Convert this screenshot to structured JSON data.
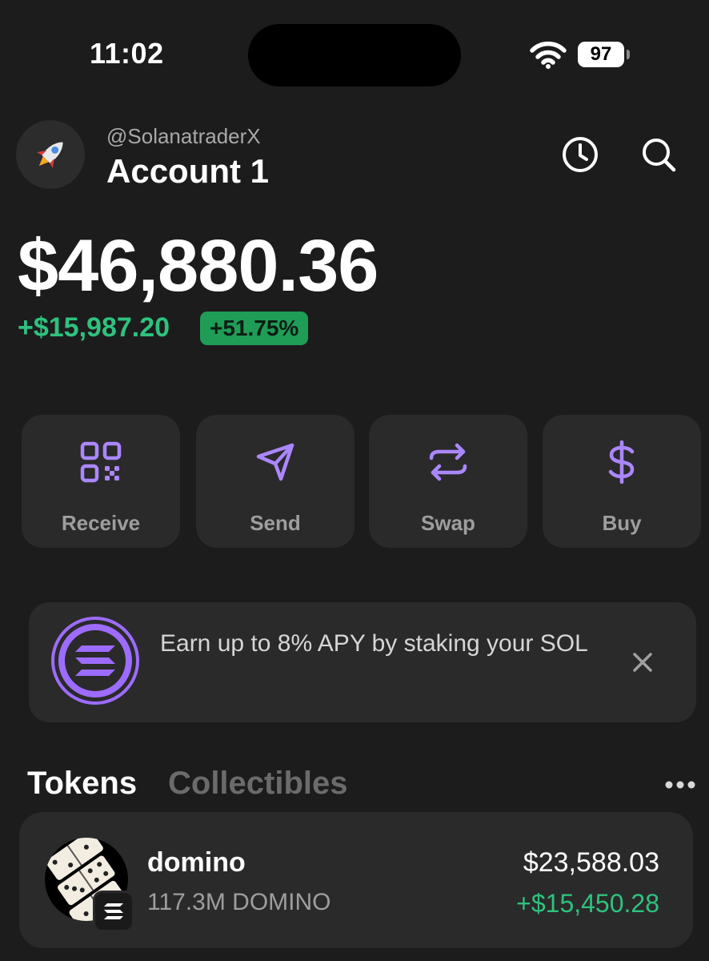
{
  "status_bar": {
    "time": "11:02",
    "battery": "97"
  },
  "header": {
    "handle": "@SolanatraderX",
    "account_name": "Account 1",
    "icons": [
      "history-icon",
      "search-icon"
    ]
  },
  "balance": {
    "total": "$46,880.36",
    "change_amount": "+$15,987.20",
    "change_percent": "+51.75%"
  },
  "actions": [
    {
      "label": "Receive",
      "icon": "qr-code-icon"
    },
    {
      "label": "Send",
      "icon": "send-icon"
    },
    {
      "label": "Swap",
      "icon": "swap-icon"
    },
    {
      "label": "Buy",
      "icon": "dollar-icon"
    }
  ],
  "banner": {
    "text": "Earn up to 8% APY by staking your SOL",
    "icon": "solana-icon"
  },
  "tabs": [
    {
      "label": "Tokens",
      "active": true
    },
    {
      "label": "Collectibles",
      "active": false
    }
  ],
  "tokens": [
    {
      "name": "domino",
      "balance": "117.3M DOMINO",
      "value": "$23,588.03",
      "change": "+$15,450.28"
    }
  ],
  "colors": {
    "background": "#1c1c1c",
    "card": "#2a2a2a",
    "accent": "#ab87ff",
    "positive": "#2ec27e",
    "positive_badge": "#1f9d57"
  }
}
